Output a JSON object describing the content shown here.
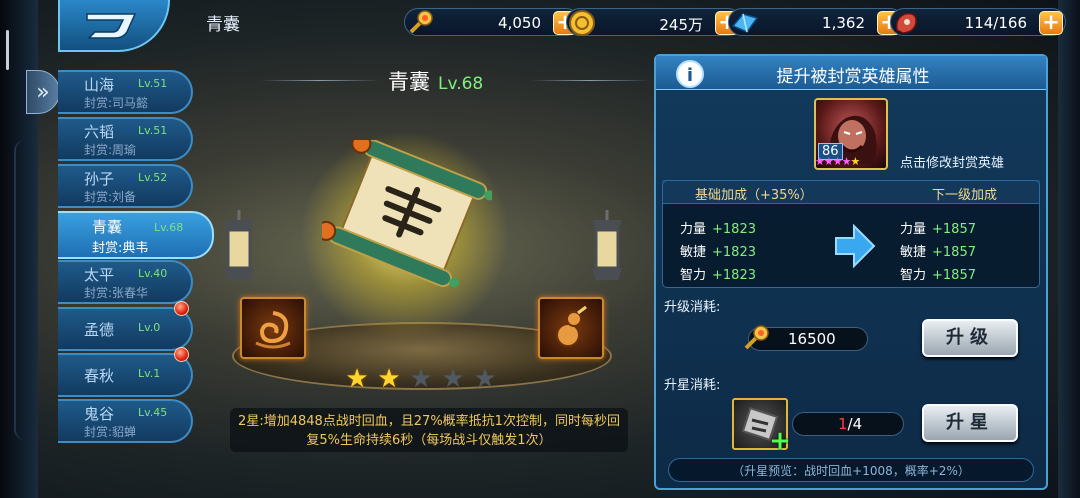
{
  "header": {
    "page_title": "青囊",
    "resources": [
      {
        "icon": "gem-scepter-icon",
        "value": "4,050"
      },
      {
        "icon": "gold-coin-icon",
        "value": "245万"
      },
      {
        "icon": "blue-crystal-icon",
        "value": "1,362"
      },
      {
        "icon": "meat-stamina-icon",
        "value": "114/166"
      }
    ]
  },
  "tabs": [
    {
      "name": "山海",
      "level": "Lv.51",
      "sub": "封赏:司马懿",
      "selected": false,
      "badge": false
    },
    {
      "name": "六韬",
      "level": "Lv.51",
      "sub": "封赏:周瑜",
      "selected": false,
      "badge": false
    },
    {
      "name": "孙子",
      "level": "Lv.52",
      "sub": "封赏:刘备",
      "selected": false,
      "badge": false
    },
    {
      "name": "青囊",
      "level": "Lv.68",
      "sub": "封赏:典韦",
      "selected": true,
      "badge": false
    },
    {
      "name": "太平",
      "level": "Lv.40",
      "sub": "封赏:张春华",
      "selected": false,
      "badge": false
    },
    {
      "name": "孟德",
      "level": "Lv.0",
      "sub": "",
      "selected": false,
      "badge": true
    },
    {
      "name": "春秋",
      "level": "Lv.1",
      "sub": "",
      "selected": false,
      "badge": true
    },
    {
      "name": "鬼谷",
      "level": "Lv.45",
      "sub": "封赏:貂蝉",
      "selected": false,
      "badge": false
    }
  ],
  "book": {
    "name": "青囊",
    "level": "Lv.68",
    "stars_filled": 2,
    "stars_total": 5,
    "description": "2星:增加4848点战时回血，且27%概率抵抗1次控制，同时每秒回复5%生命持续6秒（每场战斗仅触发1次）"
  },
  "panel": {
    "title": "提升被封赏英雄属性",
    "hero_level": "86",
    "hero_hint": "点击修改封赏英雄",
    "base_header": "基础加成（+35%）",
    "next_header": "下一级加成",
    "stats": [
      {
        "name": "力量",
        "current": "+1823",
        "next": "+1857"
      },
      {
        "name": "敏捷",
        "current": "+1823",
        "next": "+1857"
      },
      {
        "name": "智力",
        "current": "+1823",
        "next": "+1857"
      }
    ],
    "upgrade_cost_label": "升级消耗:",
    "upgrade_cost_value": "16500",
    "upgrade_button": "升级",
    "star_cost_label": "升星消耗:",
    "fragments_current": "1",
    "fragments_total": "/4",
    "star_button": "升星",
    "star_preview": "（升星预览：战时回血+1008，概率+2%）"
  },
  "colors": {
    "accent_blue": "#3aa0e0",
    "level_green": "#7ff07f",
    "description_gold": "#f0c85a",
    "star_gold": "#ffd630"
  }
}
